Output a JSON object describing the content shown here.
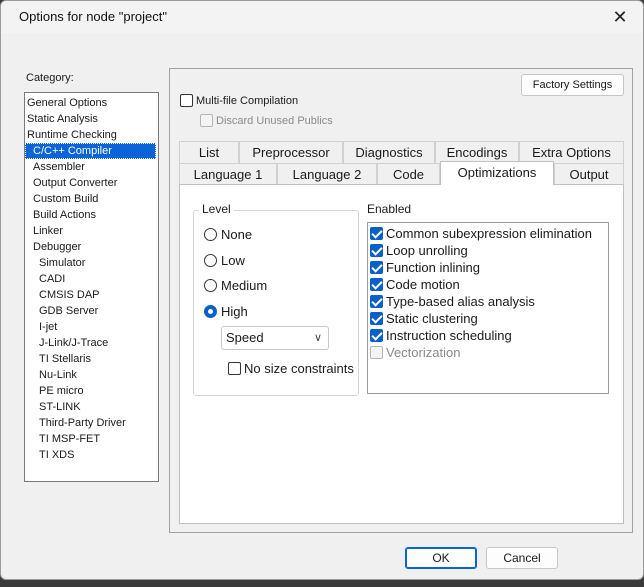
{
  "window": {
    "title": "Options for node \"project\"",
    "close_glyph": "✕"
  },
  "category": {
    "label": "Category:",
    "items": [
      {
        "label": "General Options",
        "level": 0
      },
      {
        "label": "Static Analysis",
        "level": 0
      },
      {
        "label": "Runtime Checking",
        "level": 0
      },
      {
        "label": "C/C++ Compiler",
        "level": 1,
        "selected": true
      },
      {
        "label": "Assembler",
        "level": 1
      },
      {
        "label": "Output Converter",
        "level": 1
      },
      {
        "label": "Custom Build",
        "level": 1
      },
      {
        "label": "Build Actions",
        "level": 1
      },
      {
        "label": "Linker",
        "level": 1
      },
      {
        "label": "Debugger",
        "level": 1
      },
      {
        "label": "Simulator",
        "level": 2
      },
      {
        "label": "CADI",
        "level": 2
      },
      {
        "label": "CMSIS DAP",
        "level": 2
      },
      {
        "label": "GDB Server",
        "level": 2
      },
      {
        "label": "I-jet",
        "level": 2
      },
      {
        "label": "J-Link/J-Trace",
        "level": 2
      },
      {
        "label": "TI Stellaris",
        "level": 2
      },
      {
        "label": "Nu-Link",
        "level": 2
      },
      {
        "label": "PE micro",
        "level": 2
      },
      {
        "label": "ST-LINK",
        "level": 2
      },
      {
        "label": "Third-Party Driver",
        "level": 2
      },
      {
        "label": "TI MSP-FET",
        "level": 2
      },
      {
        "label": "TI XDS",
        "level": 2
      }
    ]
  },
  "panel": {
    "factory_settings": "Factory Settings",
    "multi_file": {
      "label": "Multi-file Compilation",
      "checked": false
    },
    "discard_unused": {
      "label": "Discard Unused Publics",
      "checked": false,
      "disabled": true
    }
  },
  "tabs": {
    "row_back": [
      "List",
      "Preprocessor",
      "Diagnostics",
      "Encodings",
      "Extra Options"
    ],
    "row_front": [
      "Language 1",
      "Language 2",
      "Code",
      "Optimizations",
      "Output"
    ],
    "active": "Optimizations"
  },
  "optimizations": {
    "level_title": "Level",
    "levels": [
      {
        "label": "None",
        "checked": false
      },
      {
        "label": "Low",
        "checked": false
      },
      {
        "label": "Medium",
        "checked": false
      },
      {
        "label": "High",
        "checked": true
      }
    ],
    "speed_select": {
      "value": "Speed",
      "chevron": "∨"
    },
    "no_size_constraints": {
      "label": "No size constraints",
      "checked": false
    },
    "enabled_title": "Enabled",
    "enabled": [
      {
        "label": "Common subexpression elimination",
        "checked": true
      },
      {
        "label": "Loop unrolling",
        "checked": true
      },
      {
        "label": "Function inlining",
        "checked": true
      },
      {
        "label": "Code motion",
        "checked": true
      },
      {
        "label": "Type-based alias analysis",
        "checked": true
      },
      {
        "label": "Static clustering",
        "checked": true
      },
      {
        "label": "Instruction scheduling",
        "checked": true
      },
      {
        "label": "Vectorization",
        "checked": false,
        "disabled": true
      }
    ]
  },
  "buttons": {
    "ok": "OK",
    "cancel": "Cancel"
  },
  "colors": {
    "accent": "#0a64d8",
    "window_bg": "#f0f0f0",
    "selected_bg": "#0a64d8"
  }
}
